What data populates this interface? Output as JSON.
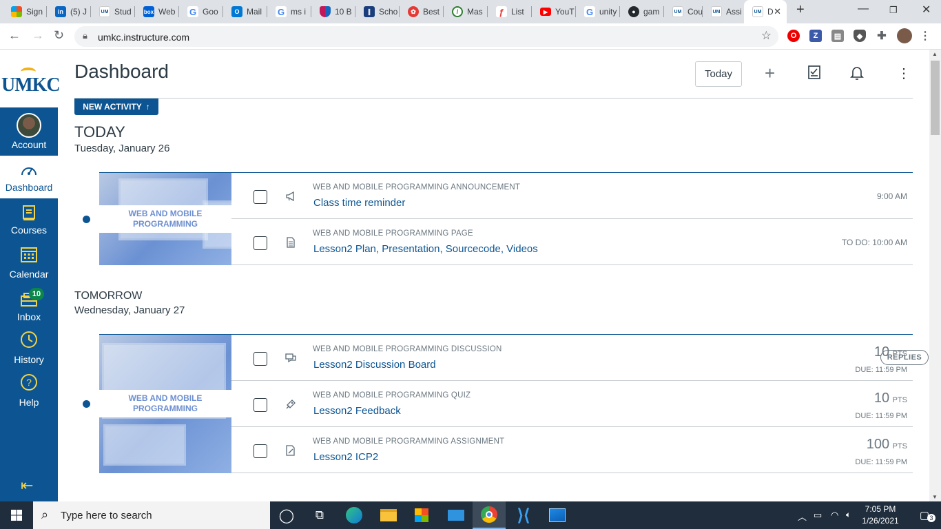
{
  "browser": {
    "tabs": [
      {
        "label": "Sign",
        "icon": "microsoft-icon",
        "color": "#f25022"
      },
      {
        "label": "(5) J",
        "icon": "linkedin-icon",
        "color": "#0a66c2"
      },
      {
        "label": "Stud",
        "icon": "umkc-icon",
        "color": "#0c5592"
      },
      {
        "label": "Web",
        "icon": "box-icon",
        "color": "#0061d5"
      },
      {
        "label": "Goo",
        "icon": "google-icon",
        "color": "#4285f4"
      },
      {
        "label": "Mail",
        "icon": "outlook-icon",
        "color": "#0078d4"
      },
      {
        "label": "ms i",
        "icon": "google-icon",
        "color": "#4285f4"
      },
      {
        "label": "10 B",
        "icon": "shield-site-icon",
        "color": "#c2185b"
      },
      {
        "label": "Scho",
        "icon": "library-icon",
        "color": "#1a3d7c"
      },
      {
        "label": "Best",
        "icon": "site-icon",
        "color": "#e53935"
      },
      {
        "label": "Mas",
        "icon": "compass-icon",
        "color": "#2e7d32"
      },
      {
        "label": "List",
        "icon": "site-icon",
        "color": "#e53935"
      },
      {
        "label": "YouT",
        "icon": "youtube-icon",
        "color": "#ff0000"
      },
      {
        "label": "unity",
        "icon": "google-icon",
        "color": "#4285f4"
      },
      {
        "label": "gam",
        "icon": "github-icon",
        "color": "#24292e"
      },
      {
        "label": "Cou",
        "icon": "umkc-icon",
        "color": "#0c5592"
      },
      {
        "label": "Assi",
        "icon": "umkc-icon",
        "color": "#0c5592"
      },
      {
        "label": "D",
        "icon": "umkc-icon",
        "color": "#0c5592"
      }
    ],
    "url": "umkc.instructure.com"
  },
  "gnav": {
    "logo": "UMKC",
    "items": [
      {
        "label": "Account",
        "icon": "avatar-icon"
      },
      {
        "label": "Dashboard",
        "icon": "dashboard-icon"
      },
      {
        "label": "Courses",
        "icon": "courses-icon"
      },
      {
        "label": "Calendar",
        "icon": "calendar-icon"
      },
      {
        "label": "Inbox",
        "icon": "inbox-icon"
      },
      {
        "label": "History",
        "icon": "history-icon"
      },
      {
        "label": "Help",
        "icon": "help-icon"
      }
    ],
    "inbox_count": "10"
  },
  "header": {
    "title": "Dashboard",
    "today_button": "Today",
    "new_activity": "NEW ACTIVITY"
  },
  "days": [
    {
      "heading": "TODAY",
      "date": "Tuesday, January 26",
      "course_label": "WEB AND MOBILE PROGRAMMING",
      "items": [
        {
          "type": "WEB AND MOBILE PROGRAMMING ANNOUNCEMENT",
          "title": "Class time reminder",
          "time": "9:00 AM",
          "icon": "announcement-icon"
        },
        {
          "type": "WEB AND MOBILE PROGRAMMING PAGE",
          "title": "Lesson2 Plan, Presentation, Sourcecode, Videos",
          "time": "TO DO: 10:00 AM",
          "icon": "page-icon"
        }
      ]
    },
    {
      "heading": "TOMORROW",
      "date": "Wednesday, January 27",
      "course_label": "WEB AND MOBILE PROGRAMMING",
      "items": [
        {
          "type": "WEB AND MOBILE PROGRAMMING DISCUSSION",
          "title": "Lesson2 Discussion Board",
          "points": "10",
          "unit": "PTS",
          "due": "DUE: 11:59 PM",
          "badge": "REPLIES",
          "icon": "discussion-icon"
        },
        {
          "type": "WEB AND MOBILE PROGRAMMING QUIZ",
          "title": "Lesson2 Feedback",
          "points": "10",
          "unit": "PTS",
          "due": "DUE: 11:59 PM",
          "icon": "quiz-icon"
        },
        {
          "type": "WEB AND MOBILE PROGRAMMING ASSIGNMENT",
          "title": "Lesson2 ICP2",
          "points": "100",
          "unit": "PTS",
          "due": "DUE: 11:59 PM",
          "icon": "assignment-icon"
        }
      ]
    }
  ],
  "taskbar": {
    "search_placeholder": "Type here to search",
    "time": "7:05 PM",
    "date": "1/26/2021",
    "notifications": "3"
  },
  "colors": {
    "canvas_blue": "#0c5592",
    "nav_icon_yellow": "#f2d348",
    "badge_green": "#0b874b"
  }
}
